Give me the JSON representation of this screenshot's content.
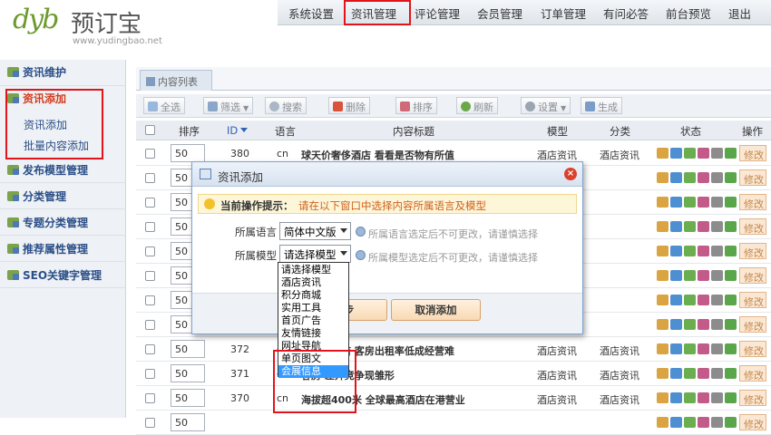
{
  "logo": {
    "mark": "dyb",
    "name": "预订宝",
    "url": "www.yudingbao.net"
  },
  "topnav": [
    "系统设置",
    "资讯管理",
    "评论管理",
    "会员管理",
    "订单管理",
    "有问必答",
    "前台预览",
    "退出"
  ],
  "sidebar": {
    "items": [
      "资讯维护",
      "资讯添加",
      "发布模型管理",
      "分类管理",
      "专题分类管理",
      "推荐属性管理",
      "SEO关键字管理"
    ],
    "sub_items": [
      "资讯添加",
      "批量内容添加"
    ]
  },
  "tab": "内容列表",
  "toolbar": [
    "全选",
    "筛选",
    "搜索",
    "删除",
    "排序",
    "刷新",
    "设置",
    "生成"
  ],
  "table": {
    "headers": [
      "排序",
      "ID",
      "语言",
      "内容标题",
      "模型",
      "分类",
      "状态",
      "操作"
    ],
    "op_label": "修改",
    "rows": [
      {
        "sort": "50",
        "id": "380",
        "lang": "cn",
        "title": "球天价奢侈酒店 看看是否物有所值",
        "model": "酒店资讯",
        "category": "酒店资讯"
      },
      {
        "sort": "50",
        "id": "",
        "lang": "",
        "title": "",
        "model": "",
        "category": ""
      },
      {
        "sort": "50",
        "id": "",
        "lang": "",
        "title": "",
        "model": "",
        "category": ""
      },
      {
        "sort": "50",
        "id": "",
        "lang": "",
        "title": "",
        "model": "",
        "category": ""
      },
      {
        "sort": "50",
        "id": "",
        "lang": "",
        "title": "",
        "model": "",
        "category": ""
      },
      {
        "sort": "50",
        "id": "",
        "lang": "",
        "title": "",
        "model": "",
        "category": ""
      },
      {
        "sort": "50",
        "id": "",
        "lang": "",
        "title": "",
        "model": "",
        "category": ""
      },
      {
        "sort": "50",
        "id": "",
        "lang": "",
        "title": "",
        "model": "",
        "category": ""
      },
      {
        "sort": "50",
        "id": "372",
        "lang": "cn",
        "title": "五星大饭店 客房出租率低成经营难",
        "model": "酒店资讯",
        "category": "酒店资讯"
      },
      {
        "sort": "50",
        "id": "371",
        "lang": "cn",
        "title": "客房 差异竞争现雏形",
        "model": "酒店资讯",
        "category": "酒店资讯"
      },
      {
        "sort": "50",
        "id": "370",
        "lang": "cn",
        "title": "海拔超400米 全球最高酒店在港营业",
        "model": "酒店资讯",
        "category": "酒店资讯"
      },
      {
        "sort": "50",
        "id": "",
        "lang": "",
        "title": "",
        "model": "",
        "category": ""
      }
    ]
  },
  "dialog": {
    "title": "资讯添加",
    "tip_label": "当前操作提示：",
    "tip_text": "请在以下窗口中选择内容所属语言及模型",
    "lang_label": "所属语言",
    "lang_value": "简体中文版",
    "lang_hint": "所属语言选定后不可更改，请谨慎选择",
    "model_label": "所属模型",
    "model_value": "请选择模型",
    "model_hint": "所属模型选定后不可更改，请谨慎选择",
    "next_button": "步",
    "cancel_button": "取消添加",
    "model_options": [
      "请选择模型",
      "酒店资讯",
      "积分商城",
      "实用工具",
      "首页广告",
      "友情链接",
      "网址导航",
      "单页图文",
      "会展信息"
    ],
    "highlighted_option": "会展信息"
  },
  "colors": {
    "annotation_red": "#e2141b",
    "nav_blue": "#2b4f88",
    "highlight": "#3399ff"
  }
}
